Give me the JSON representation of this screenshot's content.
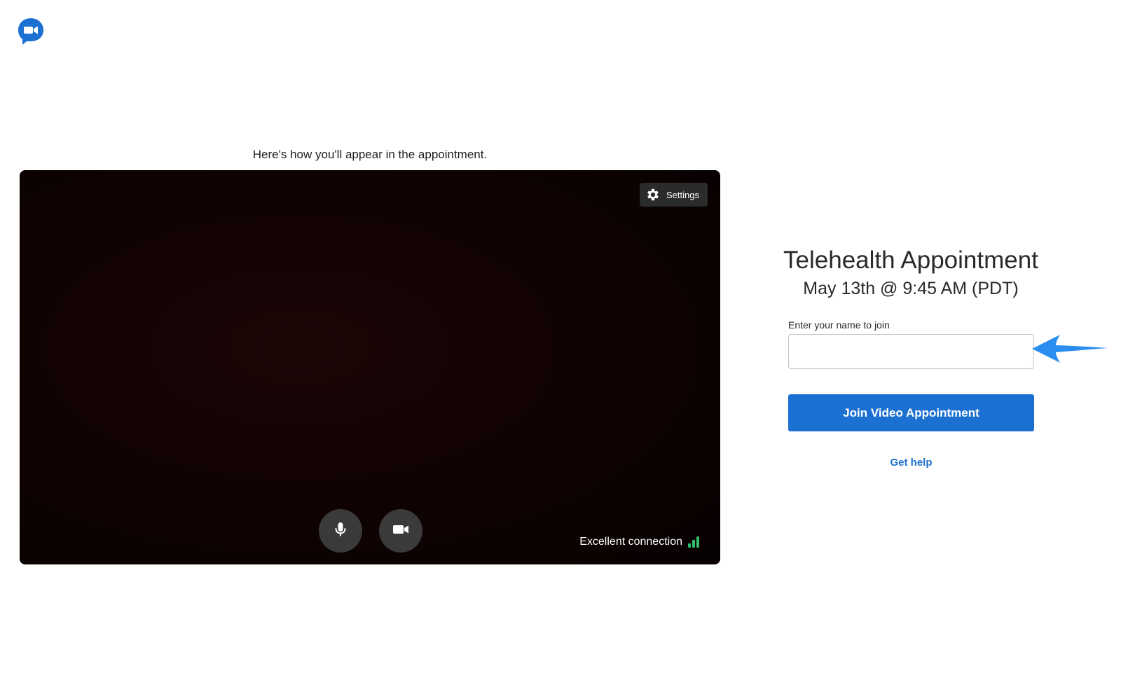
{
  "app": {
    "logo_icon": "video-chat-bubble-icon",
    "brand_color": "#1c70d1"
  },
  "preview": {
    "caption": "Here's how you'll appear in the appointment.",
    "settings_label": "Settings",
    "settings_icon": "gear-icon",
    "mic_icon": "microphone-icon",
    "camera_icon": "video-camera-icon",
    "connection_text": "Excellent connection",
    "connection_icon": "signal-bars-icon",
    "connection_color": "#2fbf6a"
  },
  "appointment": {
    "title": "Telehealth Appointment",
    "datetime": "May 13th @ 9:45 AM (PDT)"
  },
  "join_form": {
    "name_label": "Enter your name to join",
    "name_value": "",
    "name_placeholder": "",
    "join_label": "Join Video Appointment",
    "help_label": "Get help"
  },
  "annotation": {
    "arrow_icon": "pointer-arrow-icon",
    "arrow_color": "#2a8ef0"
  }
}
